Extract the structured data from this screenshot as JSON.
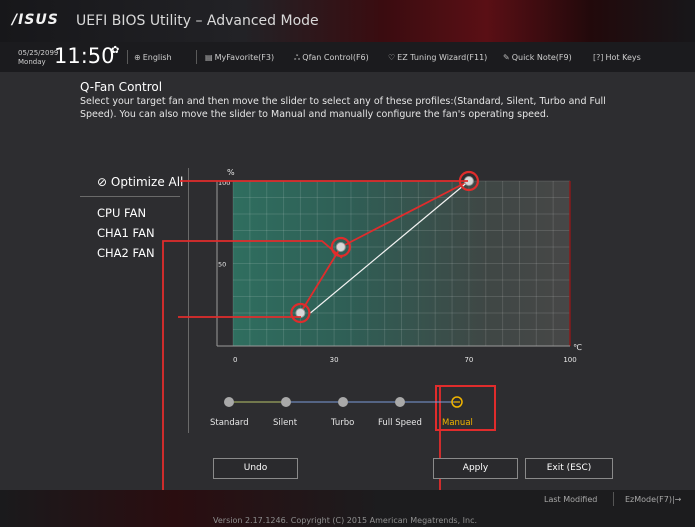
{
  "app": {
    "logo": "/ISUS",
    "title": "UEFI BIOS Utility – Advanced Mode"
  },
  "toolbar": {
    "date": "05/25/2099",
    "day": "Monday",
    "time": "11:50",
    "items": [
      {
        "icon": "globe-icon",
        "label": "English"
      },
      {
        "icon": "star-icon",
        "label": "MyFavorite(F3)"
      },
      {
        "icon": "fan-icon",
        "label": "Qfan Control(F6)"
      },
      {
        "icon": "bulb-icon",
        "label": "EZ Tuning Wizard(F11)"
      },
      {
        "icon": "note-icon",
        "label": "Quick Note(F9)"
      },
      {
        "icon": "help-icon",
        "label": "Hot Keys"
      }
    ]
  },
  "qfan": {
    "title": "Q-Fan Control",
    "description": "Select your target fan and then move the slider to select any of these profiles:(Standard, Silent, Turbo and Full Speed). You can also move the slider to Manual and manually configure the fan's operating speed."
  },
  "sidebar": {
    "optimize": "Optimize All",
    "fans": [
      "CPU FAN",
      "CHA1 FAN",
      "CHA2 FAN"
    ]
  },
  "chart_data": {
    "type": "line",
    "ylabel": "%",
    "xlabel": "℃",
    "x_ticks": [
      "0",
      "30",
      "70",
      "100"
    ],
    "y_ticks": [
      "100",
      "50"
    ],
    "xlim": [
      0,
      100
    ],
    "ylim": [
      0,
      100
    ],
    "points": [
      {
        "x": 20,
        "y": 20
      },
      {
        "x": 32,
        "y": 60
      },
      {
        "x": 70,
        "y": 100
      }
    ],
    "grid": true
  },
  "profiles": {
    "items": [
      "Standard",
      "Silent",
      "Turbo",
      "Full Speed",
      "Manual"
    ],
    "selected": "Manual"
  },
  "buttons": {
    "undo": "Undo",
    "apply": "Apply",
    "exit": "Exit (ESC)"
  },
  "footer": {
    "version": "Version 2.17.1246. Copyright (C) 2015 American Megatrends, Inc.",
    "last_modified": "Last Modified",
    "ezmode": "EzMode(F7)|→"
  },
  "colors": {
    "accent": "#e02c2c",
    "selected_profile": "#f0b400"
  }
}
